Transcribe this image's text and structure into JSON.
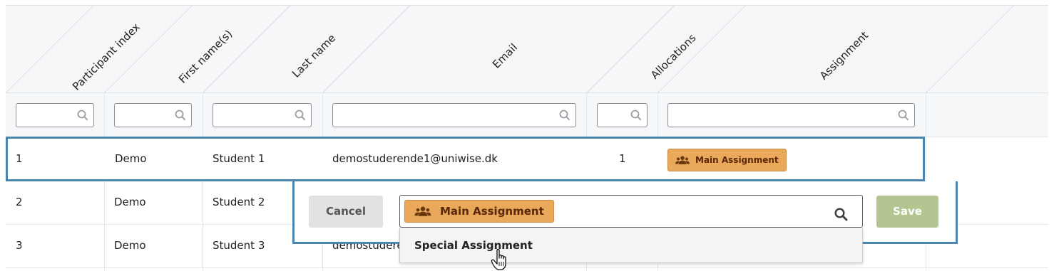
{
  "columns": {
    "participant_index": "Participant index",
    "first_names": "First name(s)",
    "last_name": "Last name",
    "email": "Email",
    "allocations": "Allocations",
    "assignment": "Assignment"
  },
  "rows": [
    {
      "index": "1",
      "first": "Demo",
      "last": "Student 1",
      "email": "demostuderende1@uniwise.dk",
      "allocations": "1",
      "assignment": "Main Assignment"
    },
    {
      "index": "2",
      "first": "Demo",
      "last": "Student 2"
    },
    {
      "index": "3",
      "first": "Demo",
      "last": "Student 3",
      "email_partial": "demostudere"
    }
  ],
  "editor": {
    "cancel_label": "Cancel",
    "save_label": "Save",
    "selected_tag": "Main Assignment",
    "options": [
      "Special Assignment"
    ]
  },
  "colors": {
    "selection_border": "#4a86b0",
    "tag_bg": "#e9a85a",
    "tag_text": "#5a2708",
    "save_disabled_bg": "#b3c692",
    "cancel_bg": "#e1e2e4"
  },
  "icons": {
    "filter": "search-icon",
    "tag": "users-group-icon",
    "cursor": "hand-pointer-icon"
  }
}
